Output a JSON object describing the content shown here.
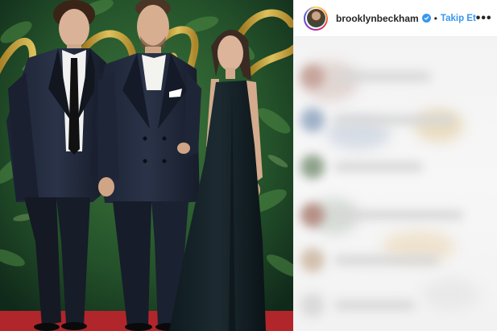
{
  "post": {
    "photo_alt": "",
    "header": {
      "username": "brooklynbeckham",
      "separator": "•",
      "follow_label": "Takip Et",
      "more_label": "•••",
      "verified_icon": "verified-badge-icon",
      "avatar_icon": "profile-avatar"
    },
    "comments": {
      "state": "blurred"
    }
  },
  "colors": {
    "accent": "#3897f0",
    "text": "#262626",
    "border": "#efefef",
    "carpet": "#b0262a",
    "foliage": "#1f4a27",
    "gold": "#c9a23a"
  }
}
